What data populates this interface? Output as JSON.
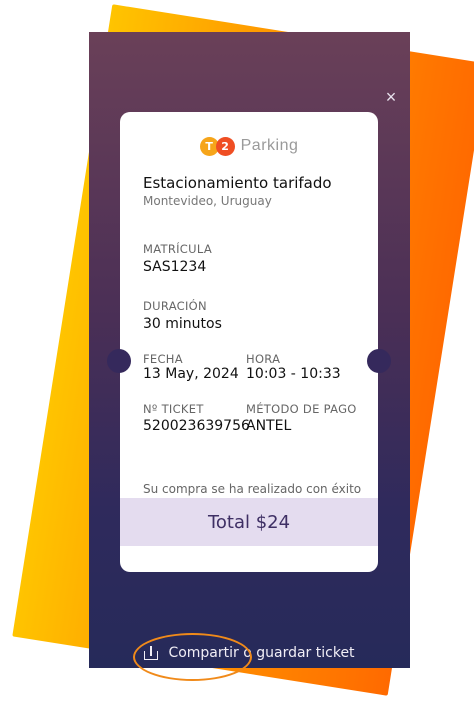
{
  "brand": {
    "logo_left": "T",
    "logo_right": "2",
    "name": "Parking"
  },
  "ticket": {
    "title": "Estacionamiento tarifado",
    "location": "Montevideo, Uruguay",
    "fields": {
      "matricula": {
        "label": "MATRÍCULA",
        "value": "SAS1234"
      },
      "duracion": {
        "label": "DURACIÓN",
        "value": "30 minutos"
      },
      "fecha": {
        "label": "FECHA",
        "value": "13 May, 2024"
      },
      "hora": {
        "label": "HORA",
        "value": "10:03 - 10:33"
      },
      "ticket_no": {
        "label": "Nº TICKET",
        "value": "520023639756"
      },
      "metodo_pago": {
        "label": "MÉTODO DE PAGO",
        "value": "ANTEL"
      }
    },
    "success_message": "Su compra se ha realizado con éxito",
    "total": "Total $24"
  },
  "actions": {
    "close_glyph": "×",
    "share_label": "Compartir o guardar ticket"
  },
  "colors": {
    "accent_orange": "#ff7a00",
    "brand_yellow": "#f6a51a",
    "brand_red": "#ef4e23",
    "total_band": "#e4dcef"
  },
  "icons": {
    "close": "close-icon",
    "share": "share-icon"
  }
}
